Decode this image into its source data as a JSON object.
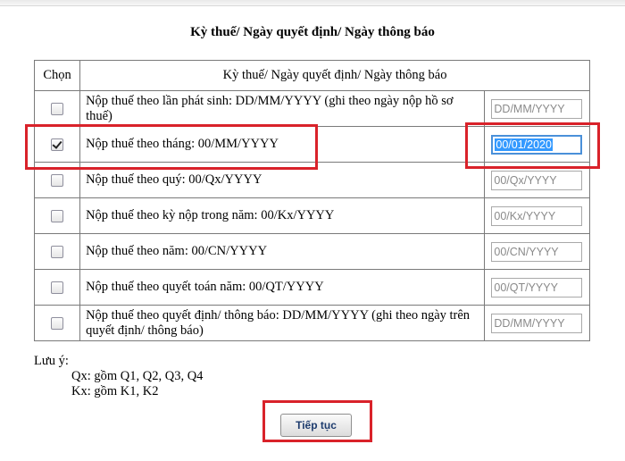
{
  "page": {
    "title": "Kỳ thuế/ Ngày quyết định/ Ngày thông báo"
  },
  "table": {
    "headers": [
      "Chọn",
      "Kỳ thuế/ Ngày quyết định/ Ngày thông báo"
    ],
    "rows": [
      {
        "label": "Nộp thuế theo lần phát sinh: DD/MM/YYYY (ghi theo ngày nộp hồ sơ thuế)",
        "checked": false,
        "placeholder": "DD/MM/YYYY",
        "value": ""
      },
      {
        "label": "Nộp thuế theo tháng: 00/MM/YYYY",
        "checked": true,
        "placeholder": "",
        "value": "00/01/2020"
      },
      {
        "label": "Nộp thuế theo quý: 00/Qx/YYYY",
        "checked": false,
        "placeholder": "00/Qx/YYYY",
        "value": ""
      },
      {
        "label": "Nộp thuế theo kỳ nộp trong năm: 00/Kx/YYYY",
        "checked": false,
        "placeholder": "00/Kx/YYYY",
        "value": ""
      },
      {
        "label": "Nộp thuế theo năm: 00/CN/YYYY",
        "checked": false,
        "placeholder": "00/CN/YYYY",
        "value": ""
      },
      {
        "label": "Nộp thuế theo quyết toán năm: 00/QT/YYYY",
        "checked": false,
        "placeholder": "00/QT/YYYY",
        "value": ""
      },
      {
        "label": "Nộp thuế theo quyết định/ thông báo: DD/MM/YYYY (ghi theo ngày trên quyết định/ thông báo)",
        "checked": false,
        "placeholder": "DD/MM/YYYY",
        "value": ""
      }
    ]
  },
  "notes": {
    "heading": "Lưu ý:",
    "lines": [
      "Qx: gồm Q1, Q2, Q3, Q4",
      "Kx: gồm K1, K2"
    ]
  },
  "continue_button": {
    "label": "Tiếp tục"
  },
  "colors": {
    "highlight_box": "#d9222a",
    "button_text": "#1e3c6e",
    "selection": "#3399ff"
  }
}
